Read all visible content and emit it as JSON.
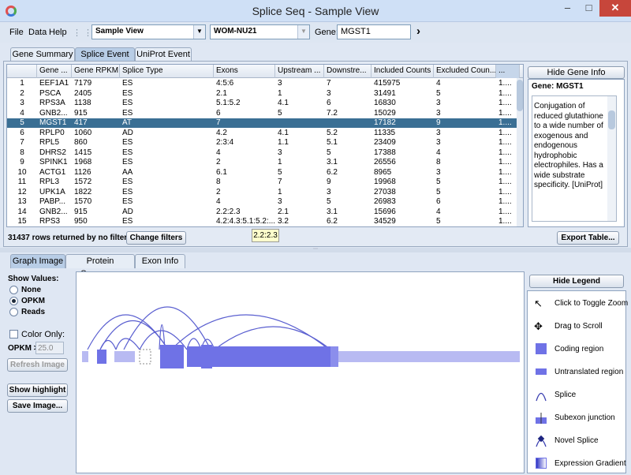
{
  "window": {
    "title": "Splice Seq - Sample View"
  },
  "menu": {
    "file": "File",
    "data": "Data",
    "help": "Help"
  },
  "toolbar": {
    "view_select": "Sample View",
    "sample_input": "WOM-NU21",
    "gene_label": "Gene:",
    "gene_input": "MGST1"
  },
  "top_tabs": [
    "Gene Summary",
    "Splice Event",
    "UniProt Event"
  ],
  "table": {
    "columns": [
      "",
      "Gene ...",
      "Gene RPKM",
      "Splice Type",
      "Exons",
      "Upstream ...",
      "Downstre...",
      "Included Counts",
      "Excluded Coun...",
      "..."
    ],
    "rows": [
      [
        "1",
        "EEF1A1",
        "7179",
        "ES",
        "4:5:6",
        "3",
        "7",
        "415975",
        "4",
        "1...."
      ],
      [
        "2",
        "PSCA",
        "2405",
        "ES",
        "2.1",
        "1",
        "3",
        "31491",
        "5",
        "1...."
      ],
      [
        "3",
        "RPS3A",
        "1138",
        "ES",
        "5.1:5.2",
        "4.1",
        "6",
        "16830",
        "3",
        "1...."
      ],
      [
        "4",
        "GNB2...",
        "915",
        "ES",
        "6",
        "5",
        "7.2",
        "15029",
        "3",
        "1...."
      ],
      [
        "5",
        "MGST1",
        "417",
        "AT",
        "7",
        "",
        "",
        "17182",
        "9",
        "1...."
      ],
      [
        "6",
        "RPLP0",
        "1060",
        "AD",
        "4.2",
        "4.1",
        "5.2",
        "11335",
        "3",
        "1...."
      ],
      [
        "7",
        "RPL5",
        "860",
        "ES",
        "2:3:4",
        "1.1",
        "5.1",
        "23409",
        "3",
        "1...."
      ],
      [
        "8",
        "DHRS2",
        "1415",
        "ES",
        "4",
        "3",
        "5",
        "17388",
        "4",
        "1...."
      ],
      [
        "9",
        "SPINK1",
        "1968",
        "ES",
        "2",
        "1",
        "3.1",
        "26556",
        "8",
        "1...."
      ],
      [
        "10",
        "ACTG1",
        "1126",
        "AA",
        "6.1",
        "5",
        "6.2",
        "8965",
        "3",
        "1...."
      ],
      [
        "11",
        "RPL3",
        "1572",
        "ES",
        "8",
        "7",
        "9",
        "19968",
        "5",
        "1...."
      ],
      [
        "12",
        "UPK1A",
        "1822",
        "ES",
        "2",
        "1",
        "3",
        "27038",
        "5",
        "1...."
      ],
      [
        "13",
        "PABP...",
        "1570",
        "ES",
        "4",
        "3",
        "5",
        "26983",
        "6",
        "1...."
      ],
      [
        "14",
        "GNB2...",
        "915",
        "AD",
        "2.2:2.3",
        "2.1",
        "3.1",
        "15696",
        "4",
        "1...."
      ],
      [
        "15",
        "RPS3",
        "950",
        "ES",
        "4.2:4.3:5.1:5.2:...",
        "3.2",
        "6.2",
        "34529",
        "5",
        "1...."
      ]
    ],
    "selected_row": 4
  },
  "gene_info": {
    "hide_button": "Hide Gene Info",
    "gene_title": "Gene: MGST1",
    "description": "Conjugation of reduced glutathione to a wide number of exogenous and endogenous hydrophobic electrophiles. Has a wide substrate specificity. [UniProt]"
  },
  "status": {
    "rows_text": "31437 rows returned by no filter",
    "change_filters": "Change filters",
    "export": "Export Table..."
  },
  "tooltip": "2.2:2.3",
  "bottom_tabs": [
    "Graph Image",
    "Protein Sequence",
    "Exon Info"
  ],
  "controls": {
    "show_values": "Show Values:",
    "none": "None",
    "opkm": "OPKM",
    "reads": "Reads",
    "color_only": "Color Only:",
    "opkm_gt": "OPKM >",
    "opkm_value": "25.0",
    "refresh": "Refresh Image",
    "show_highlight": "Show highlight",
    "save_image": "Save Image..."
  },
  "legend": {
    "hide_button": "Hide Legend",
    "items": [
      "Click to Toggle Zoom",
      "Drag to Scroll",
      "Coding region",
      "Untranslated region",
      "Splice",
      "Subexon junction",
      "Novel Splice",
      "Expression Gradient"
    ]
  },
  "colors": {
    "accent": "#3a6f94",
    "coding": "#6f72e6",
    "utr": "#b8baf2"
  }
}
